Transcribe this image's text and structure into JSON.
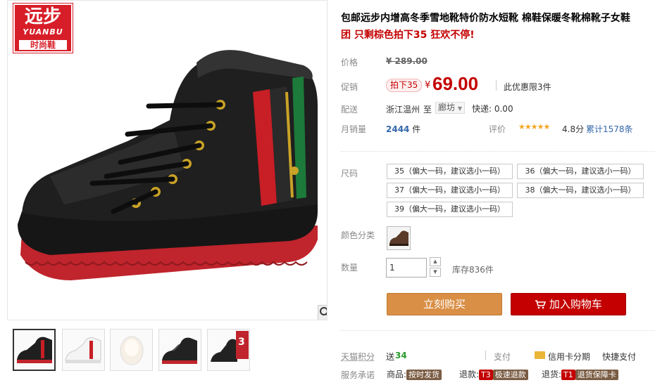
{
  "logo": {
    "brand_cn": "远步",
    "brand_en": "YUANBU",
    "tagline": "时尚鞋"
  },
  "title": {
    "main": "包邮远步内增高冬季雪地靴特价防水短靴 棉鞋保暖冬靴棉靴子女鞋",
    "promo": "团 只剩棕色拍下35 狂欢不停!"
  },
  "price": {
    "label": "价格",
    "original": "¥ 289.00"
  },
  "promo_price": {
    "label": "促销",
    "tag": "拍下35",
    "currency": "¥",
    "amount": "69.00",
    "limit": "此优惠限3件"
  },
  "shipping": {
    "label": "配送",
    "from": "浙江温州",
    "to_word": "至",
    "destination": "廊坊",
    "express": "快递: 0.00"
  },
  "sales": {
    "label": "月销量",
    "count": "2444",
    "unit": "件",
    "rating_label": "评价",
    "stars": "★★★★★",
    "score": "4.8分",
    "reviews": "累计1578条"
  },
  "size": {
    "label": "尺码",
    "options": [
      "35（偏大一码，建议选小一码）",
      "36（偏大一码，建议选小一码）",
      "37（偏大一码，建议选小一码）",
      "38（偏大一码，建议选小一码）",
      "39（偏大一码，建议选小一码）"
    ]
  },
  "color": {
    "label": "颜色分类"
  },
  "quantity": {
    "label": "数量",
    "value": "1",
    "stock": "库存836件",
    "up_icon": "chevron-up-icon",
    "down_icon": "chevron-down-icon"
  },
  "buttons": {
    "buy_now": "立刻购买",
    "add_to_cart": "加入购物车"
  },
  "footer": {
    "points_label": "天猫积分",
    "points_prefix": "送",
    "points_value": "34",
    "pay_label": "支付",
    "credit_card": "信用卡分期",
    "quick_pay": "快捷支付",
    "promise_label": "服务承诺",
    "goods_label": "商品:",
    "goods_badge": "按时发货",
    "refund_label": "退款:",
    "refund_code": "T3",
    "refund_badge": "极速退款",
    "return_label": "退货:",
    "return_code": "T1",
    "return_badge": "退货保障卡"
  },
  "colors": {
    "accent_red": "#c40000",
    "buy_orange": "#d98f45",
    "points_green": "#2a9a2a",
    "link_blue": "#3366aa"
  }
}
